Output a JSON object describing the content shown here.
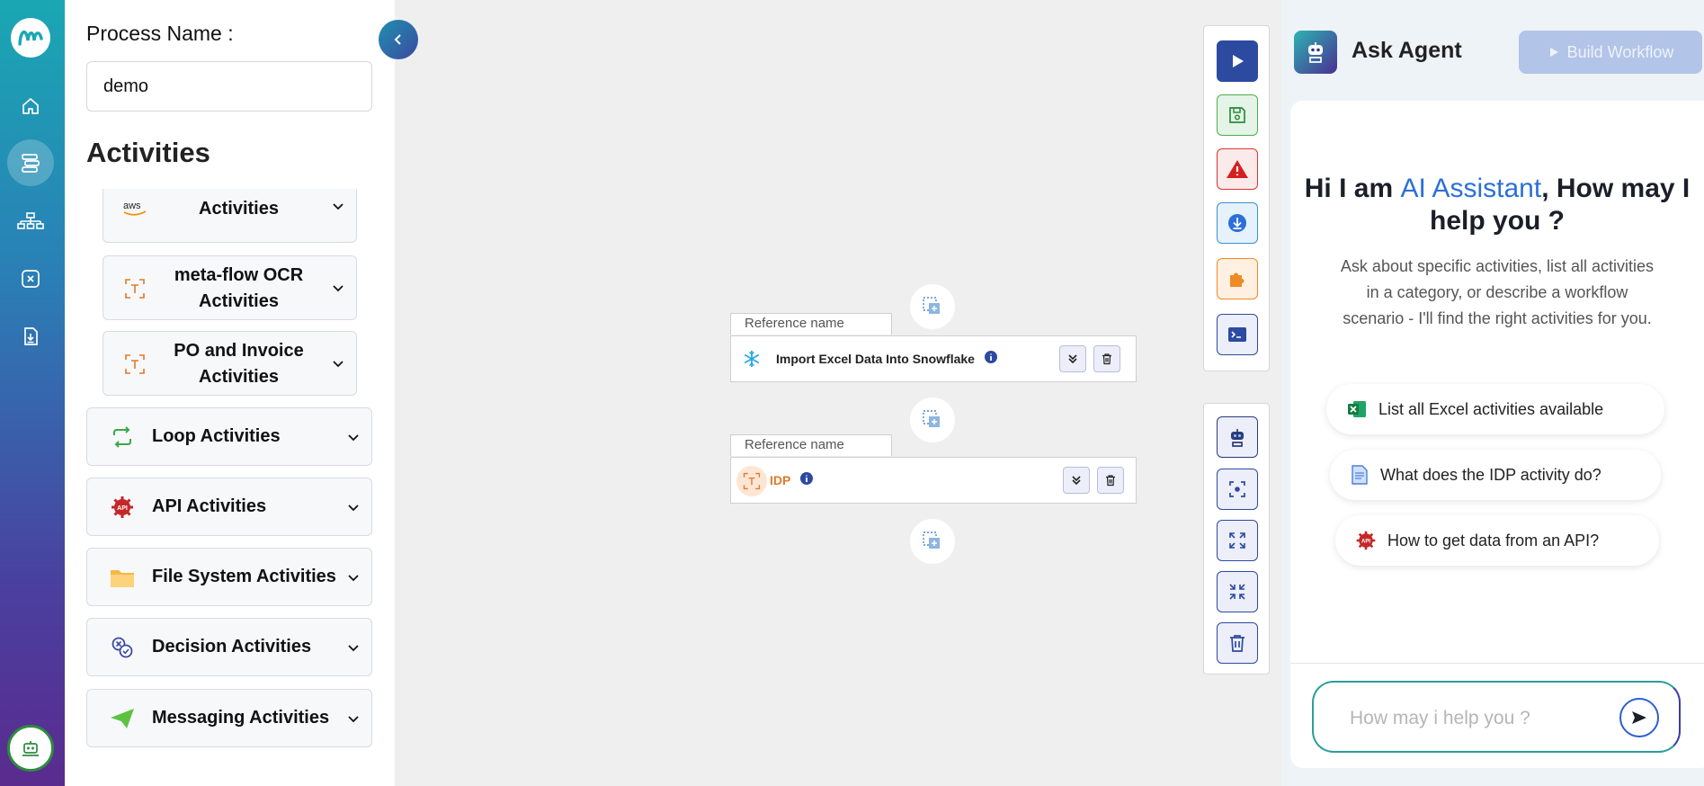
{
  "process": {
    "label": "Process Name :",
    "value": "demo"
  },
  "activities": {
    "title": "Activities",
    "sub_items": [
      {
        "label": "AWS Textract Activities",
        "icon": "aws-icon"
      },
      {
        "label": "meta-flow OCR Activities",
        "icon": "ocr-icon"
      },
      {
        "label": "PO and Invoice Activities",
        "icon": "ocr-icon"
      }
    ],
    "groups": [
      {
        "label": "Loop Activities",
        "icon": "loop-icon"
      },
      {
        "label": "API Activities",
        "icon": "api-icon"
      },
      {
        "label": "File System Activities",
        "icon": "folder-icon"
      },
      {
        "label": "Decision Activities",
        "icon": "decision-icon"
      },
      {
        "label": "Messaging Activities",
        "icon": "paper-plane-icon"
      }
    ],
    "aws_text": "aws"
  },
  "canvas": {
    "nodes": [
      {
        "ref_label": "Reference name",
        "name": "Import Excel Data Into Snowflake",
        "icon": "snowflake-icon"
      },
      {
        "ref_label": "Reference name",
        "name": "IDP",
        "icon": "ocr-icon"
      }
    ]
  },
  "agent": {
    "title": "Ask Agent",
    "build_label": "Build Workflow",
    "greet_pre": "Hi I am ",
    "greet_hl": "AI Assistant",
    "greet_post": ", How may I help you ?",
    "subtitle": "Ask about specific activities, list all activities in a category, or describe a workflow scenario - I'll find the right activities for you.",
    "suggestions": [
      {
        "text": "List all Excel activities available",
        "icon": "excel-icon"
      },
      {
        "text": "What does the IDP activity do?",
        "icon": "document-icon"
      },
      {
        "text": "How to get data from an API?",
        "icon": "api-icon"
      }
    ],
    "placeholder": "How may i help you ?"
  },
  "colors": {
    "accent": "#2c6fd8",
    "rail_top": "#1aa7b3",
    "rail_bottom": "#5a2b8f",
    "idp": "#e07a2a"
  }
}
